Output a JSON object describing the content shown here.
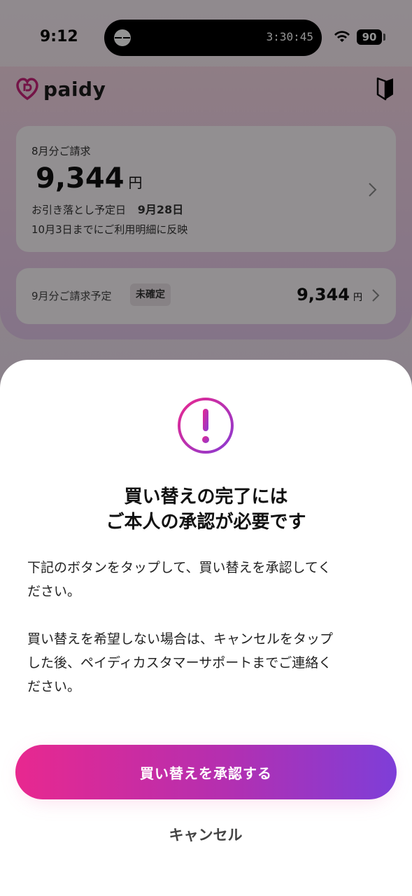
{
  "status_bar": {
    "time": "9:12",
    "timer": "3:30:45",
    "battery": "90"
  },
  "header": {
    "logo_text": "paidy",
    "logo_icon": "paidy-logo-icon",
    "right_icon": "beginner-mark-icon"
  },
  "bill_card": {
    "label": "8月分ご請求",
    "amount": "9,344",
    "currency": "円",
    "due_label": "お引き落とし予定日",
    "due_date": "9月28日",
    "note": "10月3日までにご利用明細に反映"
  },
  "next_card": {
    "label": "9月分ご請求予定",
    "badge": "未確定",
    "amount": "9,344",
    "currency": "円"
  },
  "sheet": {
    "icon": "exclamation-circle-icon",
    "title_line1": "買い替えの完了には",
    "title_line2": "ご本人の承認が必要です",
    "body_p1_line1": "下記のボタンをタップして、買い替えを承認してく",
    "body_p1_line2": "ださい。",
    "body_p2_line1": "買い替えを希望しない場合は、キャンセルをタップ",
    "body_p2_line2": "した後、ペイディカスタマーサポートまでご連絡く",
    "body_p2_line3": "ださい。",
    "approve_label": "買い替えを承認する",
    "cancel_label": "キャンセル"
  },
  "colors": {
    "brand_pink": "#e8288f",
    "brand_purple": "#7e3ed8"
  }
}
